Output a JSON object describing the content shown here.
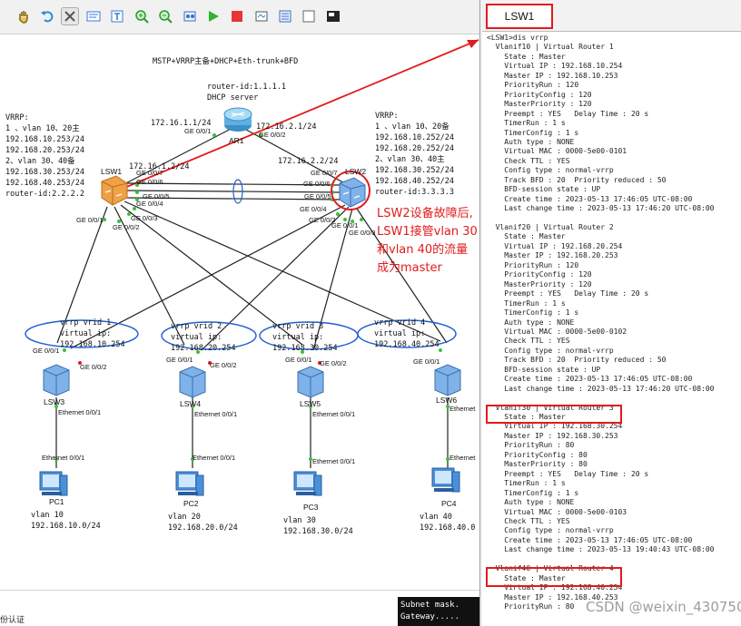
{
  "toolbar": {
    "icons": [
      "hand-icon",
      "undo-icon",
      "redo-icon",
      "stop-icon",
      "cut-icon",
      "clear-icon",
      "text-icon",
      "textbox-icon",
      "zoom-in-icon",
      "zoom-out-icon",
      "fit-icon",
      "start-icon",
      "stop-device-icon",
      "capture-icon",
      "settings-icon",
      "console-icon"
    ]
  },
  "topology": {
    "title": "MSTP+VRRP主备+DHCP+Eth-trunk+BFD",
    "ar1": {
      "label": "AR1",
      "router_id": "router-id:1.1.1.1",
      "role": "DHCP server"
    },
    "left_note": [
      "VRRP:",
      "1 、vlan 10、20主",
      "192.168.10.253/24",
      "192.168.20.253/24",
      "2、vlan 30、40备",
      "192.168.30.253/24",
      "192.168.40.253/24",
      "router-id:2.2.2.2"
    ],
    "right_note": [
      "VRRP:",
      "1 、vlan 10、20备",
      "192.168.10.252/24",
      "192.168.20.252/24",
      "2、vlan 30、40主",
      "192.168.30.252/24",
      "192.168.40.252/24",
      "router-id:3.3.3.3"
    ],
    "ips": {
      "ar1_left": "172.16.1.1/24",
      "ar1_right": "172.16.2.1/24",
      "lsw1_up": "172.16.1.2/24",
      "lsw2_up": "172.16.2.2/24"
    },
    "ports": {
      "ar1_g1": "GE 0/0/1",
      "ar1_g2": "GE 0/0/2",
      "lsw1_g7": "GE 0/0/7",
      "lsw1_g6": "GE 0/0/6",
      "lsw1_g5": "GE 0/0/5",
      "lsw1_g4": "GE 0/0/4",
      "lsw1_g3": "GE 0/0/3",
      "lsw1_g2": "GE 0/0/2",
      "lsw1_g1": "GE 0/0/1",
      "lsw2_g7": "GE 0/0/7",
      "lsw2_g6": "GE 0/0/6",
      "lsw2_g5": "GE 0/0/5",
      "lsw2_g4": "GE 0/0/4",
      "lsw2_g2": "GE 0/0/2",
      "lsw2_g1": "GE 0/0/1",
      "lsw2_g3": "GE 0/0/3",
      "lsw3_g1": "GE 0/0/1",
      "lsw3_g2": "GE 0/0/2",
      "lsw4_g1": "GE 0/0/1",
      "lsw4_g2": "GE 0/0/2",
      "lsw5_g1": "GE 0/0/1",
      "lsw5_g2": "GE 0/0/2",
      "lsw6_g1": "GE 0/0/1",
      "eth_up_1": "Ethernet 0/0/1",
      "eth_down_1": "Ethernet 0/0/1",
      "eth_up_2": "Ethernet 0/0/1",
      "eth_down_2": "Ethernet 0/0/1",
      "eth_up_3": "Ethernet 0/0/1",
      "eth_down_3": "Ethernet 0/0/1",
      "eth_up_4": "Ethernet",
      "eth_down_4": "Ethernet"
    },
    "switches": {
      "lsw1": "LSW1",
      "lsw2": "LSW2",
      "lsw3": "LSW3",
      "lsw4": "LSW4",
      "lsw5": "LSW5",
      "lsw6": "LSW6"
    },
    "vrrp_bubbles": [
      {
        "line1": "vrrp vrid 1",
        "line2": "virtual ip:",
        "line3": "192.168.10.254"
      },
      {
        "line1": "vrrp vrid 2",
        "line2": "virtual ip:",
        "line3": "192.168.20.254"
      },
      {
        "line1": "vrrp vrid 3",
        "line2": "virtual ip:",
        "line3": "192.168.30.254"
      },
      {
        "line1": "vrrp vrid 4",
        "line2": "virtual ip:",
        "line3": "192.168.40.254"
      }
    ],
    "pcs": [
      {
        "name": "PC1",
        "vlan": "vlan 10",
        "subnet": "192.168.10.0/24"
      },
      {
        "name": "PC2",
        "vlan": "vlan 20",
        "subnet": "192.168.20.0/24"
      },
      {
        "name": "PC3",
        "vlan": "vlan 30",
        "subnet": "192.168.30.0/24"
      },
      {
        "name": "PC4",
        "vlan": "vlan 40",
        "subnet": "192.168.40.0"
      }
    ],
    "annotation": [
      "LSW2设备故障后,",
      "LSW1接管vlan 30",
      "和vlan 40的流量",
      "成为master"
    ]
  },
  "console": {
    "tab_label": "LSW1",
    "lines": [
      "<LSW1>dis vrrp",
      "  Vlanif10 | Virtual Router 1",
      "    State : Master",
      "    Virtual IP : 192.168.10.254",
      "    Master IP : 192.168.10.253",
      "    PriorityRun : 120",
      "    PriorityConfig : 120",
      "    MasterPriority : 120",
      "    Preempt : YES   Delay Time : 20 s",
      "    TimerRun : 1 s",
      "    TimerConfig : 1 s",
      "    Auth type : NONE",
      "    Virtual MAC : 0000-5e00-0101",
      "    Check TTL : YES",
      "    Config type : normal-vrrp",
      "    Track BFD : 20  Priority reduced : 50",
      "    BFD-session state : UP",
      "    Create time : 2023-05-13 17:46:05 UTC-08:00",
      "    Last change time : 2023-05-13 17:46:20 UTC-08:00",
      "",
      "  Vlanif20 | Virtual Router 2",
      "    State : Master",
      "    Virtual IP : 192.168.20.254",
      "    Master IP : 192.168.20.253",
      "    PriorityRun : 120",
      "    PriorityConfig : 120",
      "    MasterPriority : 120",
      "    Preempt : YES   Delay Time : 20 s",
      "    TimerRun : 1 s",
      "    TimerConfig : 1 s",
      "    Auth type : NONE",
      "    Virtual MAC : 0000-5e00-0102",
      "    Check TTL : YES",
      "    Config type : normal-vrrp",
      "    Track BFD : 20  Priority reduced : 50",
      "    BFD-session state : UP",
      "    Create time : 2023-05-13 17:46:05 UTC-08:00",
      "    Last change time : 2023-05-13 17:46:20 UTC-08:00",
      "",
      "  Vlanif30 | Virtual Router 3",
      "    State : Master",
      "    Virtual IP : 192.168.30.254",
      "    Master IP : 192.168.30.253",
      "    PriorityRun : 80",
      "    PriorityConfig : 80",
      "    MasterPriority : 80",
      "    Preempt : YES   Delay Time : 20 s",
      "    TimerRun : 1 s",
      "    TimerConfig : 1 s",
      "    Auth type : NONE",
      "    Virtual MAC : 0000-5e00-0103",
      "    Check TTL : YES",
      "    Config type : normal-vrrp",
      "    Create time : 2023-05-13 17:46:05 UTC-08:00",
      "    Last change time : 2023-05-13 19:40:43 UTC-08:00",
      "",
      "  Vlanif40 | Virtual Router 4",
      "    State : Master",
      "    Virtual IP : 192.168.40.254",
      "    Master IP : 192.168.40.253",
      "    PriorityRun : 80"
    ]
  },
  "bottom": {
    "cmd_lines": [
      "Subnet mask.",
      "Gateway....."
    ],
    "watermark": "CSDN @weixin_43075093",
    "cn_label": "份认证"
  },
  "colors": {
    "accent_red": "#e21b1b",
    "vrrp_bubble": "#1e5fd0",
    "link_green": "#39c239"
  }
}
